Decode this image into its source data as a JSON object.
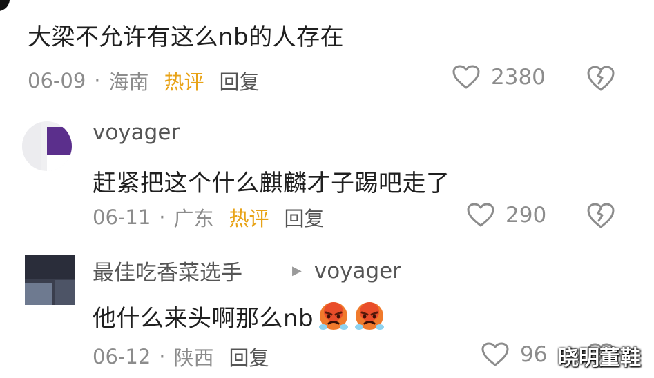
{
  "comments": [
    {
      "text": "大梁不允许有这么nb的人存在",
      "date": "06-09",
      "sep": "·",
      "location": "海南",
      "hot_label": "热评",
      "reply_label": "回复",
      "likes": "2380"
    }
  ],
  "replies": [
    {
      "username": "voyager",
      "text": "赶紧把这个什么麒麟才子踢吧走了",
      "date": "06-11",
      "sep": "·",
      "location": "广东",
      "hot_label": "热评",
      "reply_label": "回复",
      "likes": "290"
    },
    {
      "username": "最佳吃香菜选手",
      "reply_to": "voyager",
      "text": "他什么来头啊那么nb",
      "date": "06-12",
      "sep": "·",
      "location": "陕西",
      "reply_label": "回复",
      "likes": "96"
    }
  ],
  "watermark": "晓明董鞋",
  "colors": {
    "hot": "#e8a317",
    "meta": "#8c8c8c",
    "text": "#1f1f1f"
  },
  "icons": [
    "heart-outline-icon",
    "broken-heart-icon",
    "angry-emoji-icon"
  ]
}
